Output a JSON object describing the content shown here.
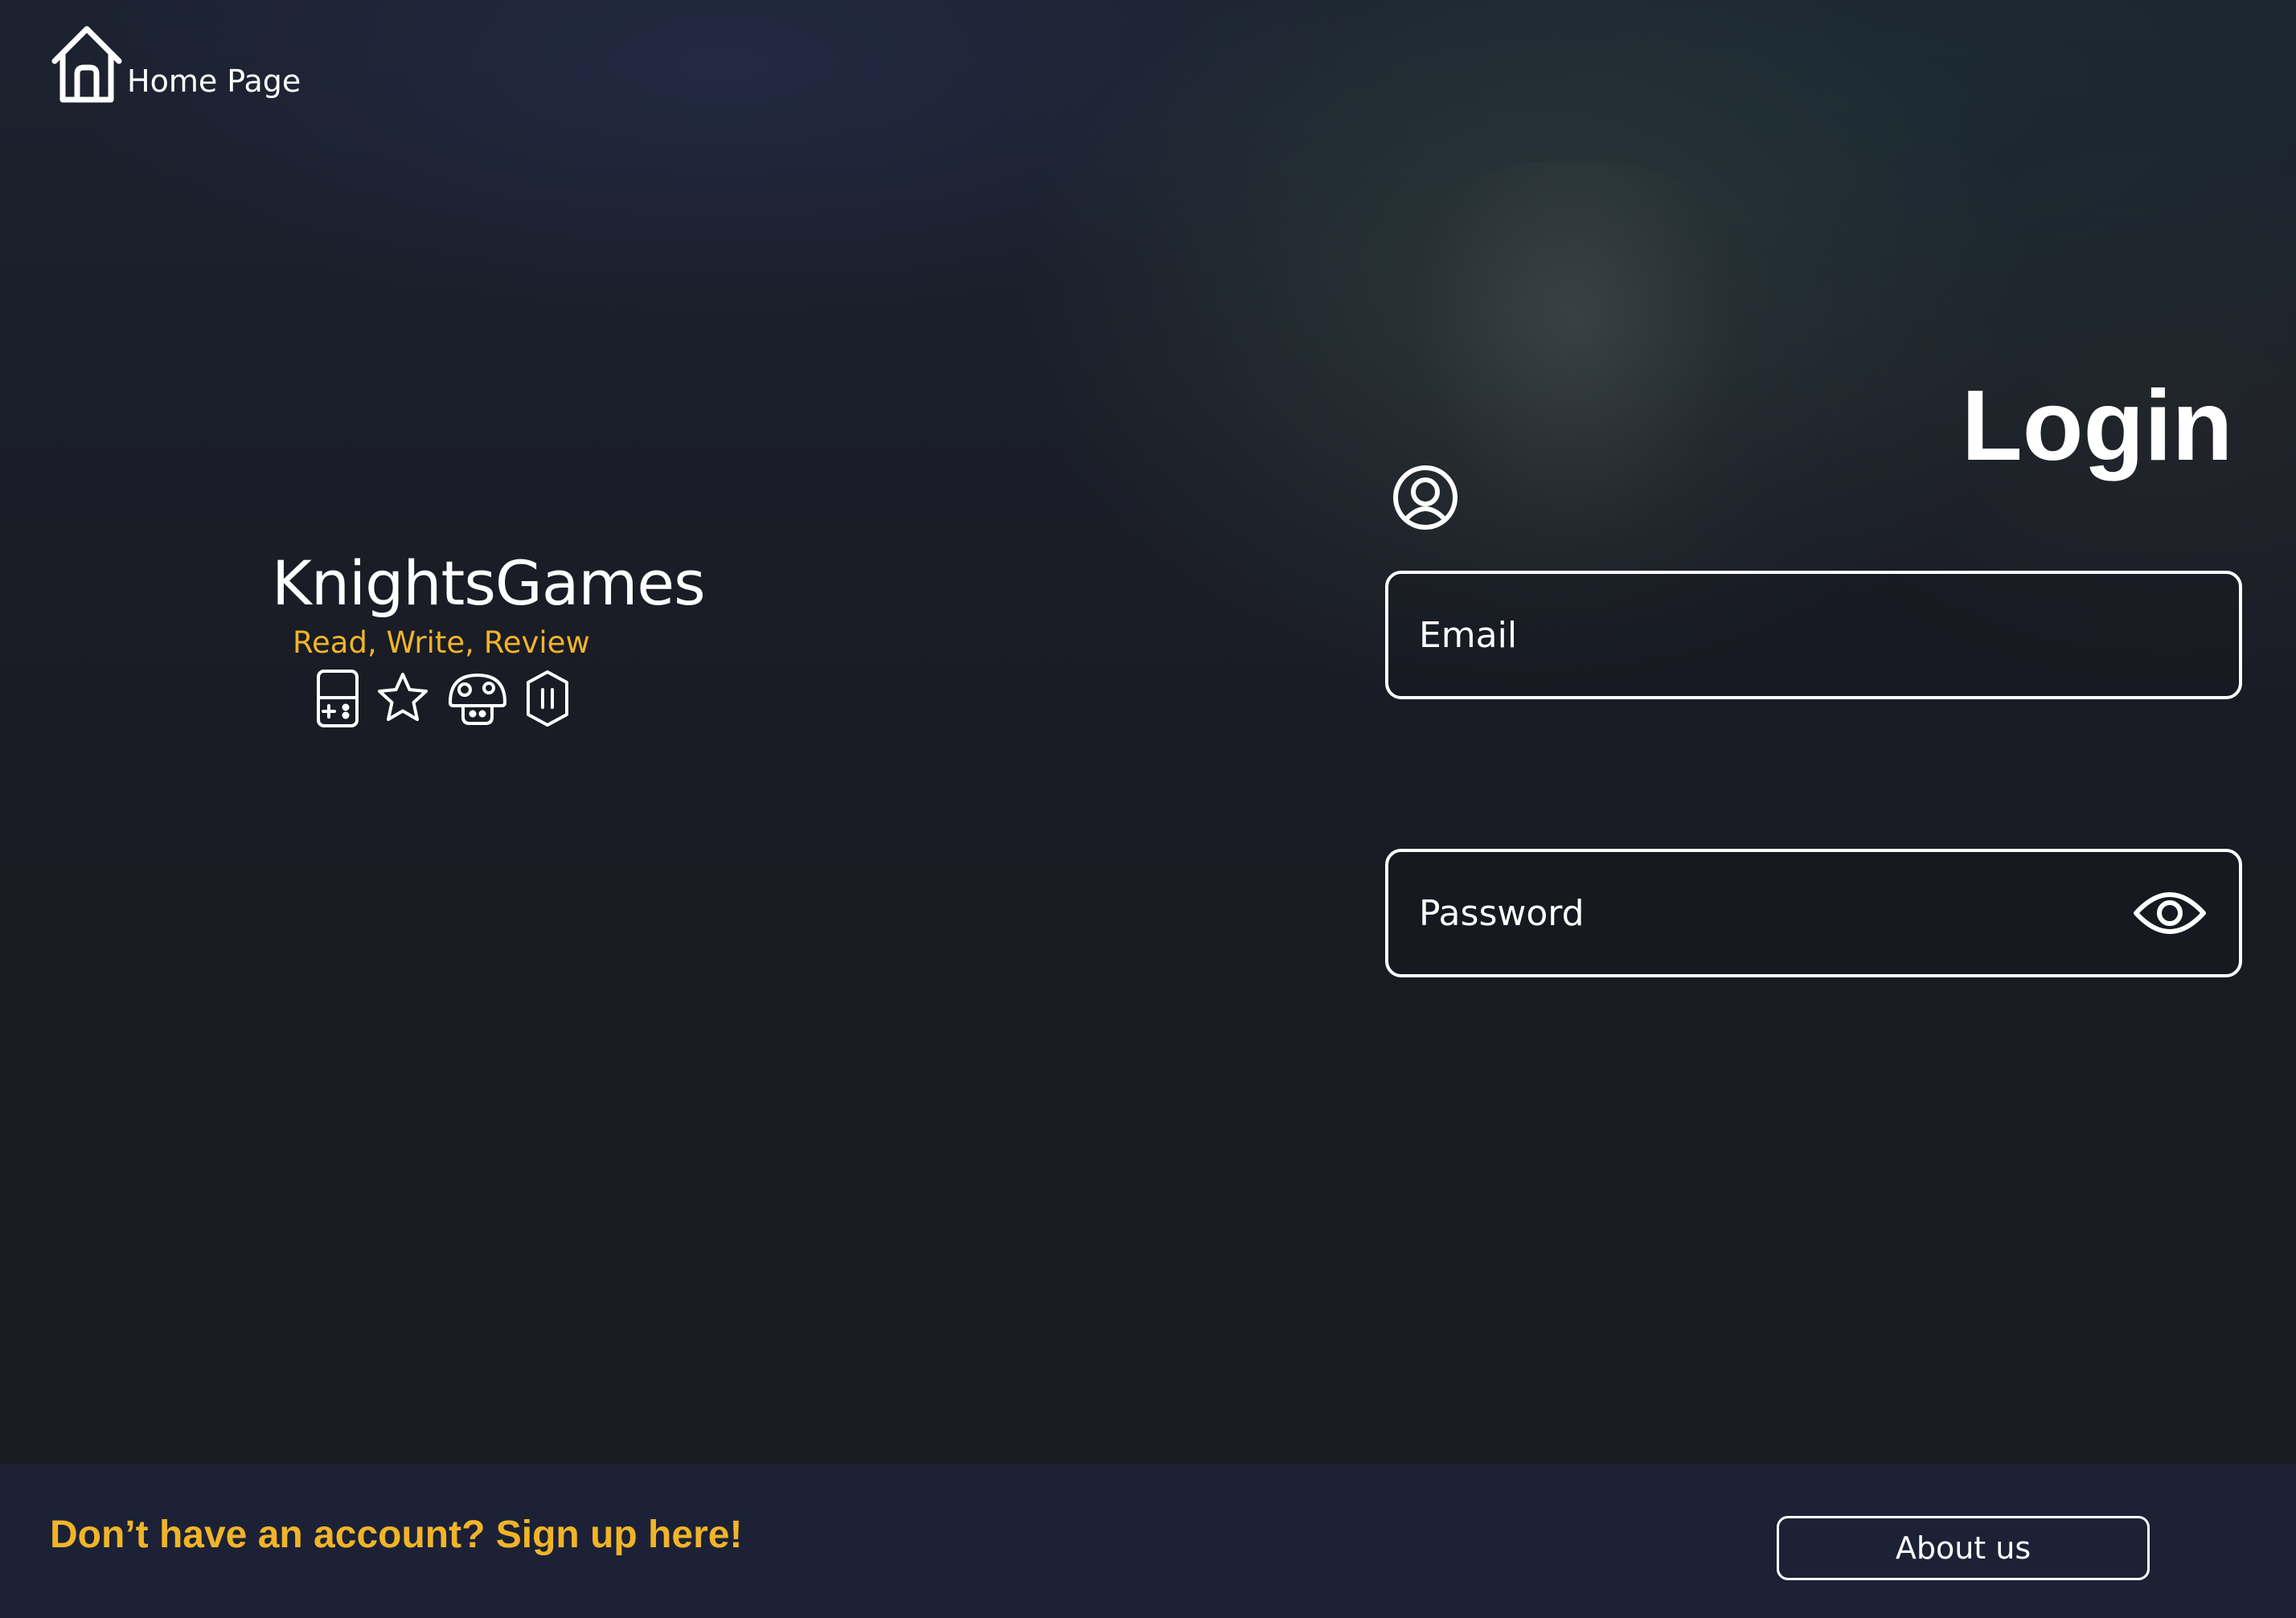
{
  "header": {
    "home_label": "Home Page",
    "home_icon": "home-icon"
  },
  "brand": {
    "name": "KnightsGames",
    "tagline": "Read, Write, Review",
    "icons": [
      "handheld-console-icon",
      "star-icon",
      "mushroom-icon",
      "gem-icon"
    ]
  },
  "login": {
    "title": "Login",
    "user_icon": "user-circle-icon",
    "email_placeholder": "Email",
    "password_placeholder": "Password",
    "password_toggle_icon": "eye-icon"
  },
  "footer": {
    "signup_text": "Don’t have an account? Sign up here!",
    "about_label": "About us"
  },
  "colors": {
    "background": "#191b23",
    "footer": "#1c2135",
    "accent": "#f0b429",
    "text": "#ffffff"
  }
}
